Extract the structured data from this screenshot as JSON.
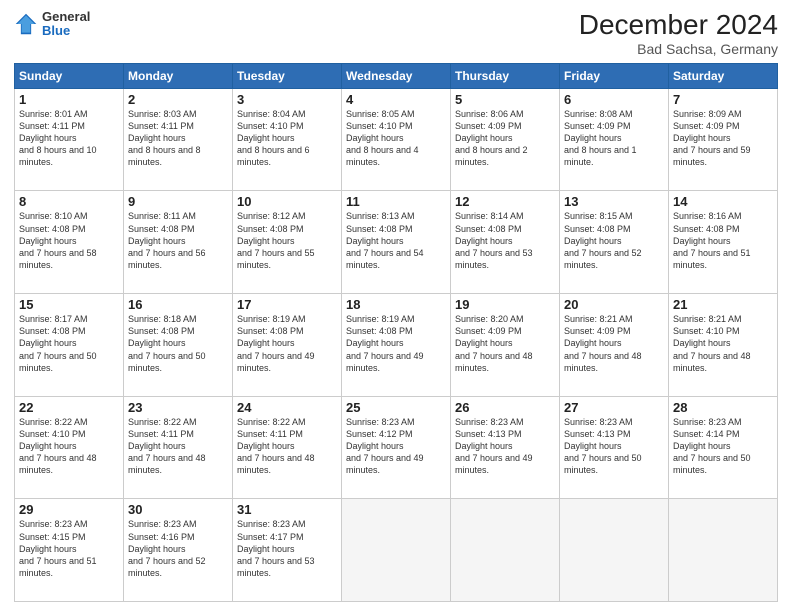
{
  "header": {
    "logo": {
      "general": "General",
      "blue": "Blue"
    },
    "title": "December 2024",
    "subtitle": "Bad Sachsa, Germany"
  },
  "weekdays": [
    "Sunday",
    "Monday",
    "Tuesday",
    "Wednesday",
    "Thursday",
    "Friday",
    "Saturday"
  ],
  "weeks": [
    [
      {
        "day": "1",
        "sunrise": "8:01 AM",
        "sunset": "4:11 PM",
        "daylight": "8 hours and 10 minutes."
      },
      {
        "day": "2",
        "sunrise": "8:03 AM",
        "sunset": "4:11 PM",
        "daylight": "8 hours and 8 minutes."
      },
      {
        "day": "3",
        "sunrise": "8:04 AM",
        "sunset": "4:10 PM",
        "daylight": "8 hours and 6 minutes."
      },
      {
        "day": "4",
        "sunrise": "8:05 AM",
        "sunset": "4:10 PM",
        "daylight": "8 hours and 4 minutes."
      },
      {
        "day": "5",
        "sunrise": "8:06 AM",
        "sunset": "4:09 PM",
        "daylight": "8 hours and 2 minutes."
      },
      {
        "day": "6",
        "sunrise": "8:08 AM",
        "sunset": "4:09 PM",
        "daylight": "8 hours and 1 minute."
      },
      {
        "day": "7",
        "sunrise": "8:09 AM",
        "sunset": "4:09 PM",
        "daylight": "7 hours and 59 minutes."
      }
    ],
    [
      {
        "day": "8",
        "sunrise": "8:10 AM",
        "sunset": "4:08 PM",
        "daylight": "7 hours and 58 minutes."
      },
      {
        "day": "9",
        "sunrise": "8:11 AM",
        "sunset": "4:08 PM",
        "daylight": "7 hours and 56 minutes."
      },
      {
        "day": "10",
        "sunrise": "8:12 AM",
        "sunset": "4:08 PM",
        "daylight": "7 hours and 55 minutes."
      },
      {
        "day": "11",
        "sunrise": "8:13 AM",
        "sunset": "4:08 PM",
        "daylight": "7 hours and 54 minutes."
      },
      {
        "day": "12",
        "sunrise": "8:14 AM",
        "sunset": "4:08 PM",
        "daylight": "7 hours and 53 minutes."
      },
      {
        "day": "13",
        "sunrise": "8:15 AM",
        "sunset": "4:08 PM",
        "daylight": "7 hours and 52 minutes."
      },
      {
        "day": "14",
        "sunrise": "8:16 AM",
        "sunset": "4:08 PM",
        "daylight": "7 hours and 51 minutes."
      }
    ],
    [
      {
        "day": "15",
        "sunrise": "8:17 AM",
        "sunset": "4:08 PM",
        "daylight": "7 hours and 50 minutes."
      },
      {
        "day": "16",
        "sunrise": "8:18 AM",
        "sunset": "4:08 PM",
        "daylight": "7 hours and 50 minutes."
      },
      {
        "day": "17",
        "sunrise": "8:19 AM",
        "sunset": "4:08 PM",
        "daylight": "7 hours and 49 minutes."
      },
      {
        "day": "18",
        "sunrise": "8:19 AM",
        "sunset": "4:08 PM",
        "daylight": "7 hours and 49 minutes."
      },
      {
        "day": "19",
        "sunrise": "8:20 AM",
        "sunset": "4:09 PM",
        "daylight": "7 hours and 48 minutes."
      },
      {
        "day": "20",
        "sunrise": "8:21 AM",
        "sunset": "4:09 PM",
        "daylight": "7 hours and 48 minutes."
      },
      {
        "day": "21",
        "sunrise": "8:21 AM",
        "sunset": "4:10 PM",
        "daylight": "7 hours and 48 minutes."
      }
    ],
    [
      {
        "day": "22",
        "sunrise": "8:22 AM",
        "sunset": "4:10 PM",
        "daylight": "7 hours and 48 minutes."
      },
      {
        "day": "23",
        "sunrise": "8:22 AM",
        "sunset": "4:11 PM",
        "daylight": "7 hours and 48 minutes."
      },
      {
        "day": "24",
        "sunrise": "8:22 AM",
        "sunset": "4:11 PM",
        "daylight": "7 hours and 48 minutes."
      },
      {
        "day": "25",
        "sunrise": "8:23 AM",
        "sunset": "4:12 PM",
        "daylight": "7 hours and 49 minutes."
      },
      {
        "day": "26",
        "sunrise": "8:23 AM",
        "sunset": "4:13 PM",
        "daylight": "7 hours and 49 minutes."
      },
      {
        "day": "27",
        "sunrise": "8:23 AM",
        "sunset": "4:13 PM",
        "daylight": "7 hours and 50 minutes."
      },
      {
        "day": "28",
        "sunrise": "8:23 AM",
        "sunset": "4:14 PM",
        "daylight": "7 hours and 50 minutes."
      }
    ],
    [
      {
        "day": "29",
        "sunrise": "8:23 AM",
        "sunset": "4:15 PM",
        "daylight": "7 hours and 51 minutes."
      },
      {
        "day": "30",
        "sunrise": "8:23 AM",
        "sunset": "4:16 PM",
        "daylight": "7 hours and 52 minutes."
      },
      {
        "day": "31",
        "sunrise": "8:23 AM",
        "sunset": "4:17 PM",
        "daylight": "7 hours and 53 minutes."
      },
      null,
      null,
      null,
      null
    ]
  ]
}
